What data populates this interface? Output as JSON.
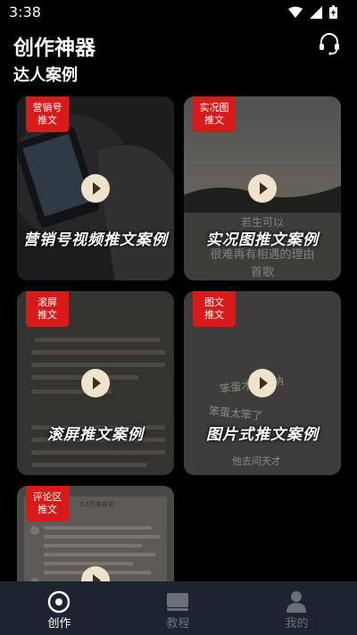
{
  "status": {
    "time": "3:38"
  },
  "header": {
    "title": "创作神器"
  },
  "section": {
    "title": "达人案例"
  },
  "cards": [
    {
      "badge_line1": "营销号",
      "badge_line2": "推文",
      "title": "营销号视频推文案例"
    },
    {
      "badge_line1": "实况图",
      "badge_line2": "推文",
      "title": "实况图推文案例",
      "bg_text_1": "若生可以",
      "bg_text_2": "很难再有相遇的理由",
      "bg_text_3": "首歌"
    },
    {
      "badge_line1": "滚屏",
      "badge_line2": "推文",
      "title": "滚屏推文案例"
    },
    {
      "badge_line1": "图文",
      "badge_line2": "推文",
      "title": "图片式推文案例",
      "bg_text_1": "笨蛋才喜欢呐",
      "bg_text_2": "笨蛋太笨了",
      "bg_text_3": "他去问天才"
    },
    {
      "badge_line1": "评论区",
      "badge_line2": "推文",
      "bg_text_1": "3.6万条评论"
    }
  ],
  "nav": [
    {
      "label": "创作",
      "icon": "create-icon",
      "active": true
    },
    {
      "label": "教程",
      "icon": "tutorial-icon",
      "active": false
    },
    {
      "label": "我的",
      "icon": "profile-icon",
      "active": false
    }
  ],
  "colors": {
    "badge": "#d81a1a",
    "nav_bg": "#1d2430",
    "nav_active": "#ffffff",
    "nav_inactive": "#6b6f78",
    "play": "#efe4cb"
  }
}
